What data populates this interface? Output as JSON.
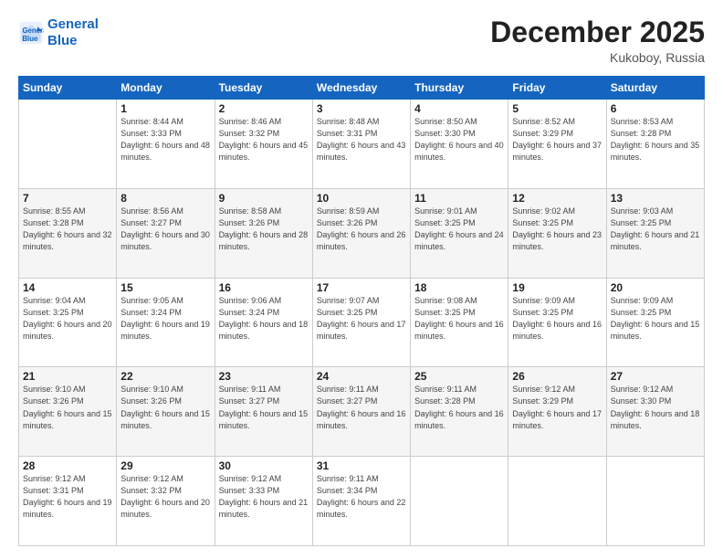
{
  "header": {
    "logo_line1": "General",
    "logo_line2": "Blue",
    "month": "December 2025",
    "location": "Kukoboy, Russia"
  },
  "days_of_week": [
    "Sunday",
    "Monday",
    "Tuesday",
    "Wednesday",
    "Thursday",
    "Friday",
    "Saturday"
  ],
  "weeks": [
    [
      {
        "day": "",
        "sunrise": "",
        "sunset": "",
        "daylight": ""
      },
      {
        "day": "1",
        "sunrise": "Sunrise: 8:44 AM",
        "sunset": "Sunset: 3:33 PM",
        "daylight": "Daylight: 6 hours and 48 minutes."
      },
      {
        "day": "2",
        "sunrise": "Sunrise: 8:46 AM",
        "sunset": "Sunset: 3:32 PM",
        "daylight": "Daylight: 6 hours and 45 minutes."
      },
      {
        "day": "3",
        "sunrise": "Sunrise: 8:48 AM",
        "sunset": "Sunset: 3:31 PM",
        "daylight": "Daylight: 6 hours and 43 minutes."
      },
      {
        "day": "4",
        "sunrise": "Sunrise: 8:50 AM",
        "sunset": "Sunset: 3:30 PM",
        "daylight": "Daylight: 6 hours and 40 minutes."
      },
      {
        "day": "5",
        "sunrise": "Sunrise: 8:52 AM",
        "sunset": "Sunset: 3:29 PM",
        "daylight": "Daylight: 6 hours and 37 minutes."
      },
      {
        "day": "6",
        "sunrise": "Sunrise: 8:53 AM",
        "sunset": "Sunset: 3:28 PM",
        "daylight": "Daylight: 6 hours and 35 minutes."
      }
    ],
    [
      {
        "day": "7",
        "sunrise": "Sunrise: 8:55 AM",
        "sunset": "Sunset: 3:28 PM",
        "daylight": "Daylight: 6 hours and 32 minutes."
      },
      {
        "day": "8",
        "sunrise": "Sunrise: 8:56 AM",
        "sunset": "Sunset: 3:27 PM",
        "daylight": "Daylight: 6 hours and 30 minutes."
      },
      {
        "day": "9",
        "sunrise": "Sunrise: 8:58 AM",
        "sunset": "Sunset: 3:26 PM",
        "daylight": "Daylight: 6 hours and 28 minutes."
      },
      {
        "day": "10",
        "sunrise": "Sunrise: 8:59 AM",
        "sunset": "Sunset: 3:26 PM",
        "daylight": "Daylight: 6 hours and 26 minutes."
      },
      {
        "day": "11",
        "sunrise": "Sunrise: 9:01 AM",
        "sunset": "Sunset: 3:25 PM",
        "daylight": "Daylight: 6 hours and 24 minutes."
      },
      {
        "day": "12",
        "sunrise": "Sunrise: 9:02 AM",
        "sunset": "Sunset: 3:25 PM",
        "daylight": "Daylight: 6 hours and 23 minutes."
      },
      {
        "day": "13",
        "sunrise": "Sunrise: 9:03 AM",
        "sunset": "Sunset: 3:25 PM",
        "daylight": "Daylight: 6 hours and 21 minutes."
      }
    ],
    [
      {
        "day": "14",
        "sunrise": "Sunrise: 9:04 AM",
        "sunset": "Sunset: 3:25 PM",
        "daylight": "Daylight: 6 hours and 20 minutes."
      },
      {
        "day": "15",
        "sunrise": "Sunrise: 9:05 AM",
        "sunset": "Sunset: 3:24 PM",
        "daylight": "Daylight: 6 hours and 19 minutes."
      },
      {
        "day": "16",
        "sunrise": "Sunrise: 9:06 AM",
        "sunset": "Sunset: 3:24 PM",
        "daylight": "Daylight: 6 hours and 18 minutes."
      },
      {
        "day": "17",
        "sunrise": "Sunrise: 9:07 AM",
        "sunset": "Sunset: 3:25 PM",
        "daylight": "Daylight: 6 hours and 17 minutes."
      },
      {
        "day": "18",
        "sunrise": "Sunrise: 9:08 AM",
        "sunset": "Sunset: 3:25 PM",
        "daylight": "Daylight: 6 hours and 16 minutes."
      },
      {
        "day": "19",
        "sunrise": "Sunrise: 9:09 AM",
        "sunset": "Sunset: 3:25 PM",
        "daylight": "Daylight: 6 hours and 16 minutes."
      },
      {
        "day": "20",
        "sunrise": "Sunrise: 9:09 AM",
        "sunset": "Sunset: 3:25 PM",
        "daylight": "Daylight: 6 hours and 15 minutes."
      }
    ],
    [
      {
        "day": "21",
        "sunrise": "Sunrise: 9:10 AM",
        "sunset": "Sunset: 3:26 PM",
        "daylight": "Daylight: 6 hours and 15 minutes."
      },
      {
        "day": "22",
        "sunrise": "Sunrise: 9:10 AM",
        "sunset": "Sunset: 3:26 PM",
        "daylight": "Daylight: 6 hours and 15 minutes."
      },
      {
        "day": "23",
        "sunrise": "Sunrise: 9:11 AM",
        "sunset": "Sunset: 3:27 PM",
        "daylight": "Daylight: 6 hours and 15 minutes."
      },
      {
        "day": "24",
        "sunrise": "Sunrise: 9:11 AM",
        "sunset": "Sunset: 3:27 PM",
        "daylight": "Daylight: 6 hours and 16 minutes."
      },
      {
        "day": "25",
        "sunrise": "Sunrise: 9:11 AM",
        "sunset": "Sunset: 3:28 PM",
        "daylight": "Daylight: 6 hours and 16 minutes."
      },
      {
        "day": "26",
        "sunrise": "Sunrise: 9:12 AM",
        "sunset": "Sunset: 3:29 PM",
        "daylight": "Daylight: 6 hours and 17 minutes."
      },
      {
        "day": "27",
        "sunrise": "Sunrise: 9:12 AM",
        "sunset": "Sunset: 3:30 PM",
        "daylight": "Daylight: 6 hours and 18 minutes."
      }
    ],
    [
      {
        "day": "28",
        "sunrise": "Sunrise: 9:12 AM",
        "sunset": "Sunset: 3:31 PM",
        "daylight": "Daylight: 6 hours and 19 minutes."
      },
      {
        "day": "29",
        "sunrise": "Sunrise: 9:12 AM",
        "sunset": "Sunset: 3:32 PM",
        "daylight": "Daylight: 6 hours and 20 minutes."
      },
      {
        "day": "30",
        "sunrise": "Sunrise: 9:12 AM",
        "sunset": "Sunset: 3:33 PM",
        "daylight": "Daylight: 6 hours and 21 minutes."
      },
      {
        "day": "31",
        "sunrise": "Sunrise: 9:11 AM",
        "sunset": "Sunset: 3:34 PM",
        "daylight": "Daylight: 6 hours and 22 minutes."
      },
      {
        "day": "",
        "sunrise": "",
        "sunset": "",
        "daylight": ""
      },
      {
        "day": "",
        "sunrise": "",
        "sunset": "",
        "daylight": ""
      },
      {
        "day": "",
        "sunrise": "",
        "sunset": "",
        "daylight": ""
      }
    ]
  ]
}
